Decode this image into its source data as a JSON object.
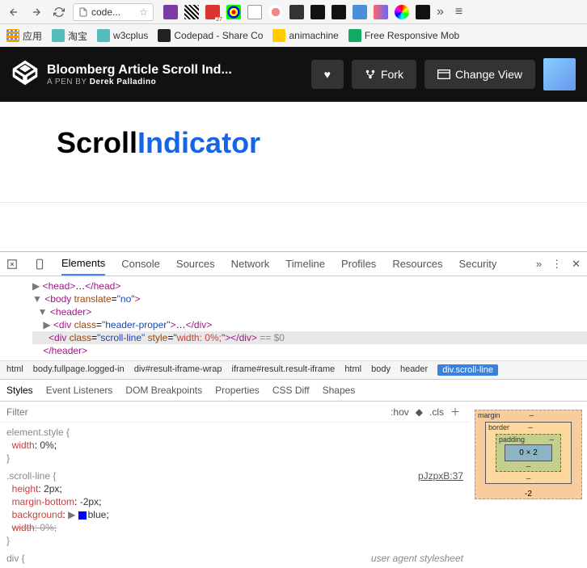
{
  "toolbar": {
    "url": "code..."
  },
  "bookmarks": {
    "apps": "应用",
    "tb": "淘宝",
    "w3c": "w3cplus",
    "codepad": "Codepad - Share Co",
    "anim": "animachine",
    "free": "Free Responsive Mob"
  },
  "codepen": {
    "title": "Bloomberg Article Scroll Ind...",
    "by_prefix": "A PEN BY",
    "author": "Derek Palladino",
    "fork": "Fork",
    "change_view": "Change View"
  },
  "page": {
    "scroll": "Scroll",
    "indicator": "Indicator"
  },
  "devtools": {
    "tabs": {
      "elements": "Elements",
      "console": "Console",
      "sources": "Sources",
      "network": "Network",
      "timeline": "Timeline",
      "profiles": "Profiles",
      "resources": "Resources",
      "security": "Security"
    }
  },
  "dom": {
    "line1_open": "<head>",
    "line1_dots": "…",
    "line1_close": "</head>",
    "line2": "<body translate=\"no\">",
    "line3": "<header>",
    "line4_a": "<div class=",
    "line4_b": "\"header-proper\"",
    "line4_c": ">…</div>",
    "line5_a": "<div class=",
    "line5_b": "\"scroll-line\"",
    "line5_c": " style=",
    "line5_d": "\"width: 0%;\"",
    "line5_e": "></div>",
    "line5_f": " == $0",
    "line6": "</header>"
  },
  "crumbs": {
    "c1": "html",
    "c2": "body.fullpage.logged-in",
    "c3": "div#result-iframe-wrap",
    "c4": "iframe#result.result-iframe",
    "c5": "html",
    "c6": "body",
    "c7": "header",
    "c8": "div.scroll-line"
  },
  "styles_tabs": {
    "styles": "Styles",
    "listeners": "Event Listeners",
    "dom_bp": "DOM Breakpoints",
    "props": "Properties",
    "cssdiff": "CSS Diff",
    "shapes": "Shapes"
  },
  "filter": {
    "placeholder": "Filter",
    "hov": ":hov",
    "cls": ".cls"
  },
  "css": {
    "elstyle": "element.style {",
    "width_prop": "width",
    "width_val": "0%",
    "scroll_sel": ".scroll-line {",
    "height_prop": "height",
    "height_val": "2px",
    "mb_prop": "margin-bottom",
    "mb_val": "-2px",
    "bg_prop": "background",
    "bg_val": "blue",
    "w2_prop": "width",
    "w2_val": "0%",
    "div_sel": "div {",
    "link": "pJzpxB:37",
    "ua": "user agent stylesheet",
    "close": "}"
  },
  "box": {
    "margin": "margin",
    "border": "border",
    "padding": "padding",
    "content": "0 × 2",
    "dash": "–",
    "mb": "-2"
  }
}
